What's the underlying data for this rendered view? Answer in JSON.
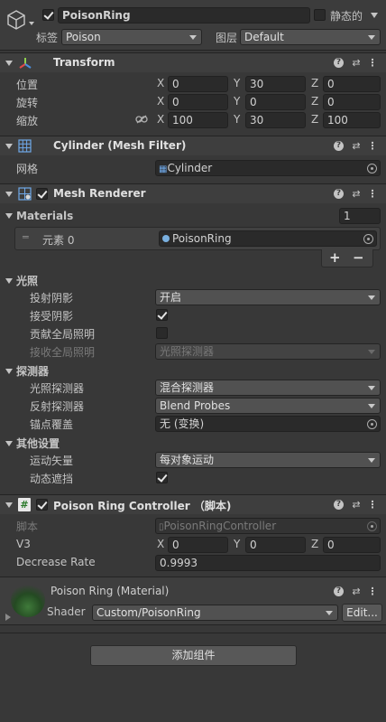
{
  "go": {
    "name": "PoisonRing",
    "static_label": "静态的",
    "tag_label": "标签",
    "tag_value": "Poison",
    "layer_label": "图层",
    "layer_value": "Default"
  },
  "transform": {
    "title": "Transform",
    "position_label": "位置",
    "rotation_label": "旋转",
    "scale_label": "缩放",
    "axes": [
      "X",
      "Y",
      "Z"
    ],
    "position": [
      "0",
      "30",
      "0"
    ],
    "rotation": [
      "0",
      "0",
      "0"
    ],
    "scale": [
      "100",
      "30",
      "100"
    ]
  },
  "mesh_filter": {
    "title": "Cylinder (Mesh Filter)",
    "mesh_label": "网格",
    "mesh_value": "Cylinder"
  },
  "mesh_renderer": {
    "title": "Mesh Renderer",
    "materials_label": "Materials",
    "materials_count": "1",
    "element_label": "元素 0",
    "element_value": "PoisonRing",
    "plus": "+",
    "minus": "−",
    "lighting_label": "光照",
    "cast_shadows_label": "投射阴影",
    "cast_shadows_value": "开启",
    "receive_shadows_label": "接受阴影",
    "contribute_gi_label": "贡献全局照明",
    "receive_gi_label": "接收全局照明",
    "receive_gi_value": "光照探测器",
    "probes_label": "探测器",
    "light_probes_label": "光照探测器",
    "light_probes_value": "混合探测器",
    "reflection_probes_label": "反射探测器",
    "reflection_probes_value": "Blend Probes",
    "anchor_label": "锚点覆盖",
    "anchor_value": "无 (变换)",
    "other_label": "其他设置",
    "motion_vectors_label": "运动矢量",
    "motion_vectors_value": "每对象运动",
    "dynamic_occlusion_label": "动态遮挡"
  },
  "controller": {
    "title": "Poison Ring Controller （脚本)",
    "script_label": "脚本",
    "script_value": "PoisonRingController",
    "v3_label": "V3",
    "v3": [
      "0",
      "0",
      "0"
    ],
    "decrease_label": "Decrease Rate",
    "decrease_value": "0.9993"
  },
  "material": {
    "title": "Poison Ring (Material)",
    "shader_label": "Shader",
    "shader_value": "Custom/PoisonRing",
    "edit_label": "Edit..."
  },
  "add_component_label": "添加组件",
  "colors": {
    "bg": "#383838",
    "header": "#3e3e3e",
    "field": "#2a2a2a",
    "dropdown": "#515151"
  }
}
